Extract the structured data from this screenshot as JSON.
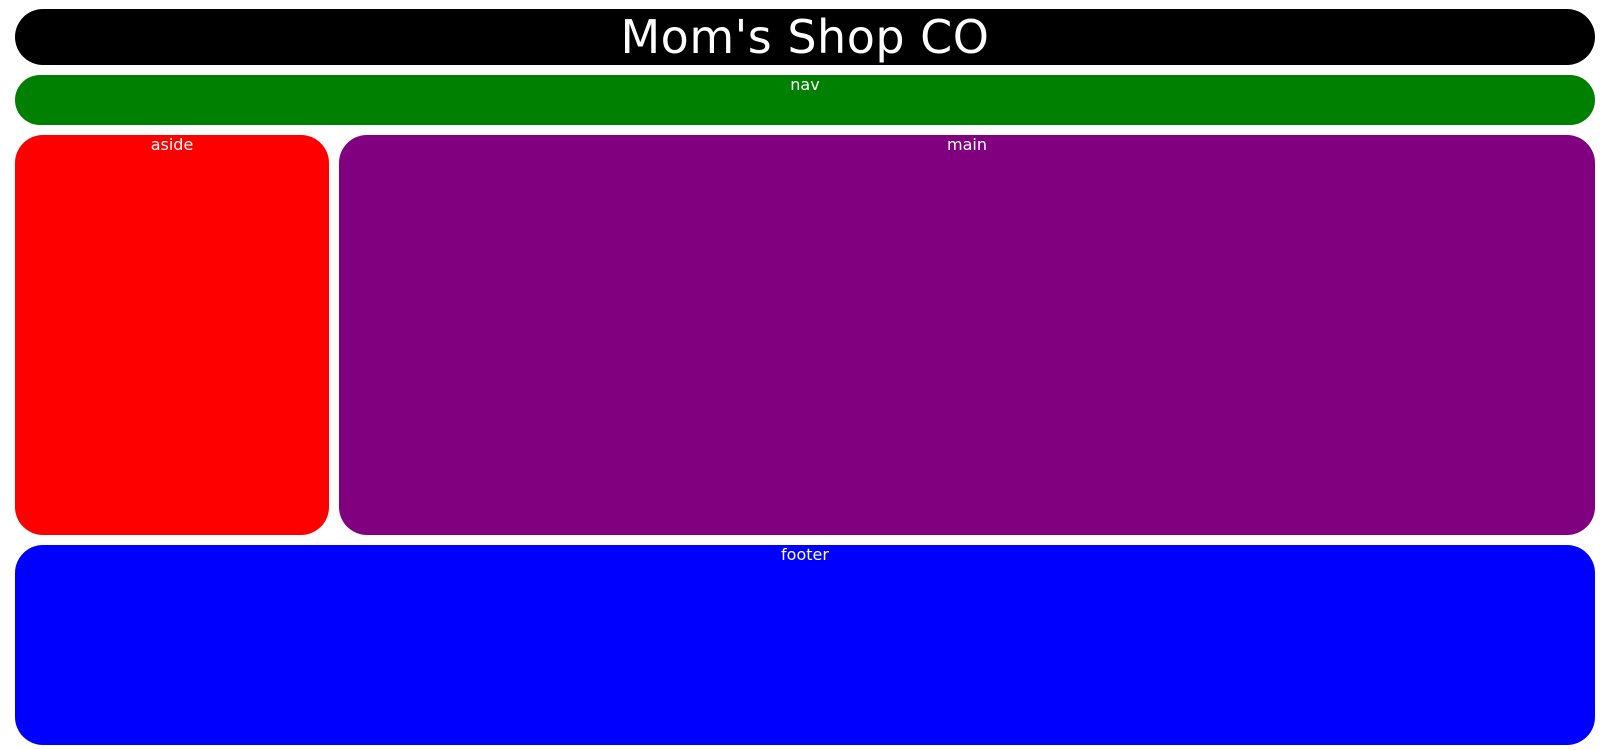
{
  "header": {
    "title": "Mom's Shop CO"
  },
  "nav": {
    "label": "nav"
  },
  "aside": {
    "label": "aside"
  },
  "main": {
    "label": "main"
  },
  "footer": {
    "label": "footer"
  },
  "colors": {
    "header": "#000000",
    "nav": "#008000",
    "aside": "#ff0000",
    "main": "#800080",
    "footer": "#0000ff",
    "text": "#ffffff"
  }
}
